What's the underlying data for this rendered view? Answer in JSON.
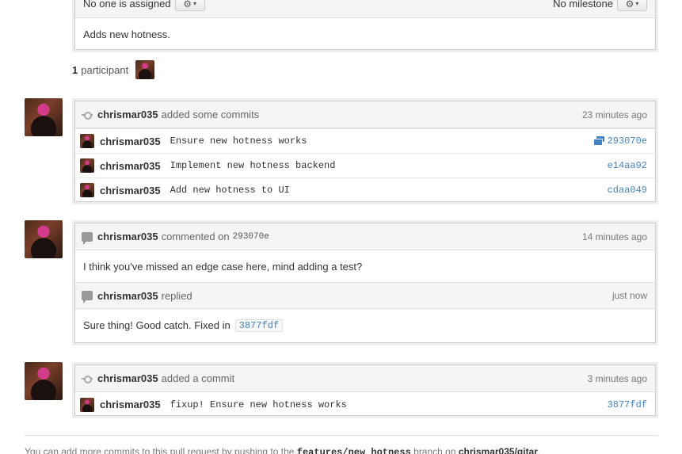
{
  "top_box": {
    "assignee_text": "No one is assigned",
    "milestone_text": "No milestone",
    "description": "Adds new hotness."
  },
  "participants": {
    "count": "1",
    "label": "participant"
  },
  "events": [
    {
      "type": "commits",
      "author": "chrismar035",
      "action": "added some commits",
      "time": "23 minutes ago",
      "commits": [
        {
          "author": "chrismar035",
          "message": "Ensure new hotness works",
          "sha": "293070e",
          "has_comments": true
        },
        {
          "author": "chrismar035",
          "message": "Implement new hotness backend",
          "sha": "e14aa92",
          "has_comments": false
        },
        {
          "author": "chrismar035",
          "message": "Add new hotness to UI",
          "sha": "cdaa049",
          "has_comments": false
        }
      ]
    },
    {
      "type": "comment",
      "author": "chrismar035",
      "action": "commented on",
      "target_sha": "293070e",
      "time": "14 minutes ago",
      "body": "I think you've missed an edge case here, mind adding a test?",
      "reply": {
        "author": "chrismar035",
        "action": "replied",
        "time": "just now",
        "body": "Sure thing! Good catch. Fixed in",
        "sha": "3877fdf"
      }
    },
    {
      "type": "commit",
      "author": "chrismar035",
      "action": "added a commit",
      "time": "3 minutes ago",
      "commits": [
        {
          "author": "chrismar035",
          "message": "fixup! Ensure new hotness works",
          "sha": "3877fdf"
        }
      ]
    }
  ],
  "footer": {
    "prefix": "You can add more commits to this pull request by pushing to the",
    "branch": "features/new_hotness",
    "middle": "branch on",
    "repo": "chrismar035/gitar",
    "suffix": "."
  }
}
